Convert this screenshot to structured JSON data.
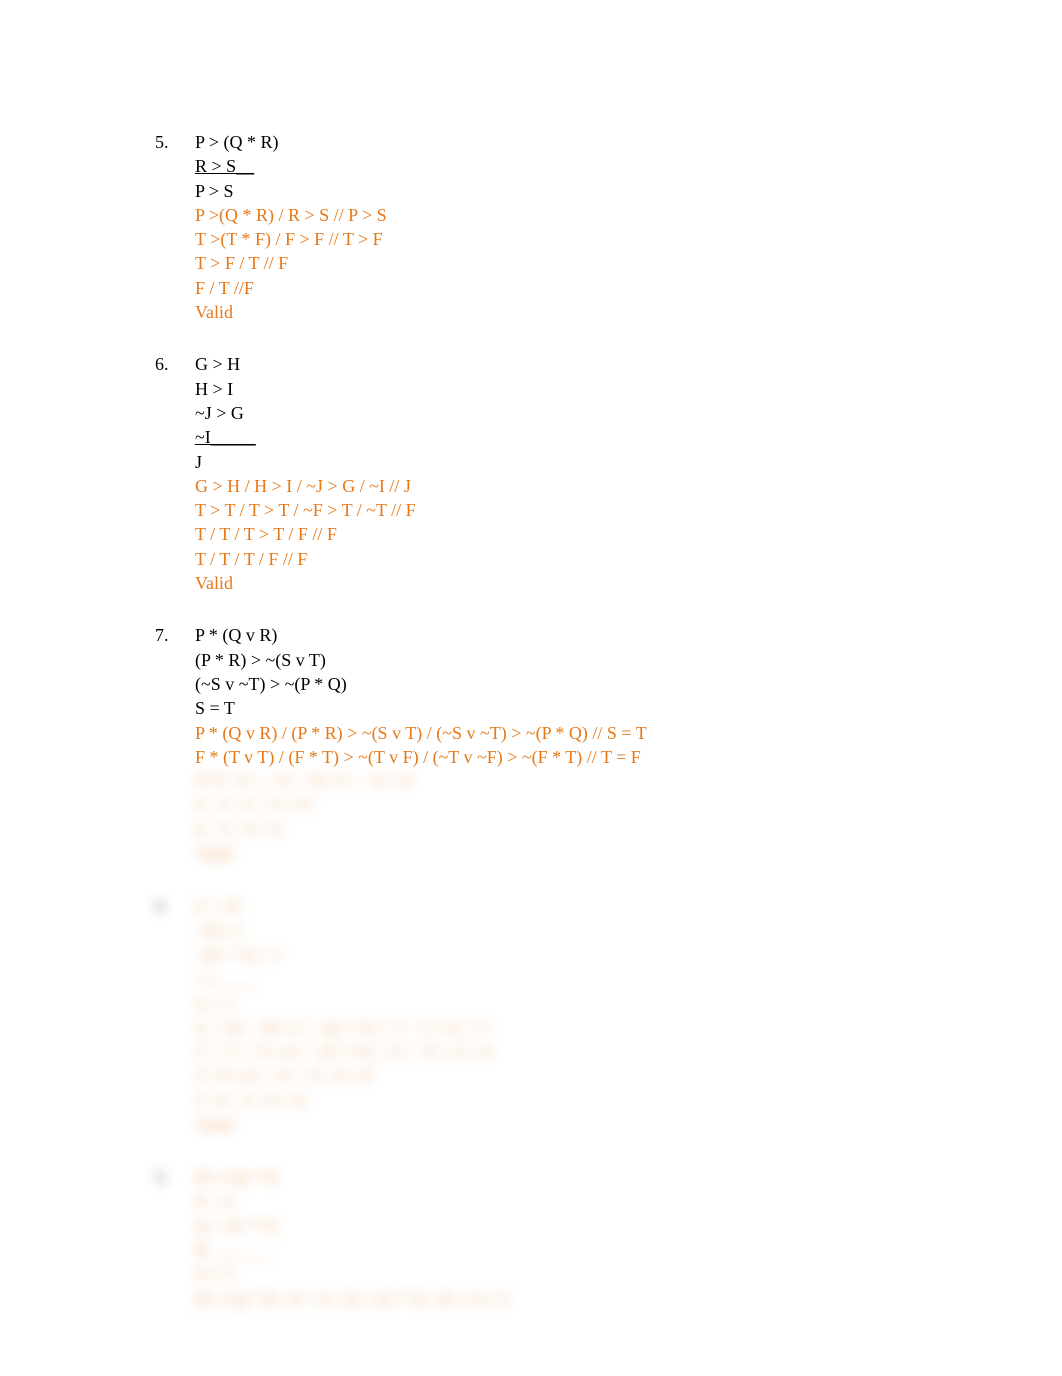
{
  "problems": [
    {
      "number": "5.",
      "lines": [
        {
          "text": "P > (Q * R)",
          "orange": false
        },
        {
          "text": "R > S__",
          "orange": false
        },
        {
          "text": "P > S",
          "orange": false
        },
        {
          "text": "P >(Q * R) / R > S // P > S",
          "orange": true
        },
        {
          "text": "T >(T * F) / F > F // T > F",
          "orange": true
        },
        {
          "text": "T > F / T // F",
          "orange": true
        },
        {
          "text": "F / T //F",
          "orange": true
        },
        {
          "text": "Valid",
          "orange": true
        }
      ]
    },
    {
      "number": "6.",
      "lines": [
        {
          "text": " G > H",
          "orange": false
        },
        {
          "text": "H > I",
          "orange": false
        },
        {
          "text": "~J > G",
          "orange": false
        },
        {
          "text": "~I_____",
          "orange": false
        },
        {
          "text": "J",
          "orange": false
        },
        {
          "text": "G > H / H > I / ~J > G / ~I // J",
          "orange": true
        },
        {
          "text": "T > T / T > T / ~F > T / ~T // F",
          "orange": true
        },
        {
          "text": "T / T / T > T / F // F",
          "orange": true
        },
        {
          "text": "T / T / T / F // F",
          "orange": true
        },
        {
          "text": "Valid",
          "orange": true
        }
      ]
    },
    {
      "number": "7.",
      "lines": [
        {
          "text": " P * (Q v R)",
          "orange": false
        },
        {
          "text": "(P * R) > ~(S v T)",
          "orange": false
        },
        {
          "text": "(~S v ~T) > ~(P * Q)",
          "orange": false
        },
        {
          "text": "S = T",
          "orange": false
        },
        {
          "text": "P * (Q v R) / (P * R) > ~(S v T) / (~S v ~T) > ~(P * Q) // S = T",
          "orange": true
        },
        {
          "text": "F * (T v T) / (F * T) > ~(T v F) / (~T v ~F) > ~(F * T) // T = F",
          "orange": true
        }
      ],
      "blurredTail": [
        {
          "text": "F*T / F > ~T / ~Tv T > ~F // F",
          "orange": true
        },
        {
          "text": "F / T / T > T // F",
          "orange": true
        },
        {
          "text": "F / T / T // F",
          "orange": true
        },
        {
          "text": "Valid",
          "orange": true
        }
      ]
    }
  ],
  "blurredProblems": [
    {
      "number": "8.",
      "lines": [
        {
          "text": "G > H",
          "orange": false
        },
        {
          "text": "~H v I",
          "orange": false
        },
        {
          "text": "~(G * I) > J",
          "orange": false
        },
        {
          "text": "~J_____",
          "orange": false
        },
        {
          "text": "G = I",
          "orange": false
        },
        {
          "text": "G > H / ~H v I / ~(G * I) > J / ~J // G = I",
          "orange": true
        },
        {
          "text": "T > T / ~T v F / ~(T * F) > T / ~T // T = F",
          "orange": true
        },
        {
          "text": "T / F v F / ~F > T / F // F",
          "orange": true
        },
        {
          "text": "T / F / T / F // F",
          "orange": true
        },
        {
          "text": "Valid",
          "orange": true
        }
      ]
    },
    {
      "number": "9.",
      "lines": [
        {
          "text": "(P v Q) * R",
          "orange": false
        },
        {
          "text": "P > S",
          "orange": false
        },
        {
          "text": "Q > (S * T)",
          "orange": false
        },
        {
          "text": "R_______",
          "orange": false
        },
        {
          "text": "S v T",
          "orange": false
        },
        {
          "text": "(P v Q) * R / P > S / Q > (S * T) / R // S v T",
          "orange": true
        }
      ]
    }
  ]
}
